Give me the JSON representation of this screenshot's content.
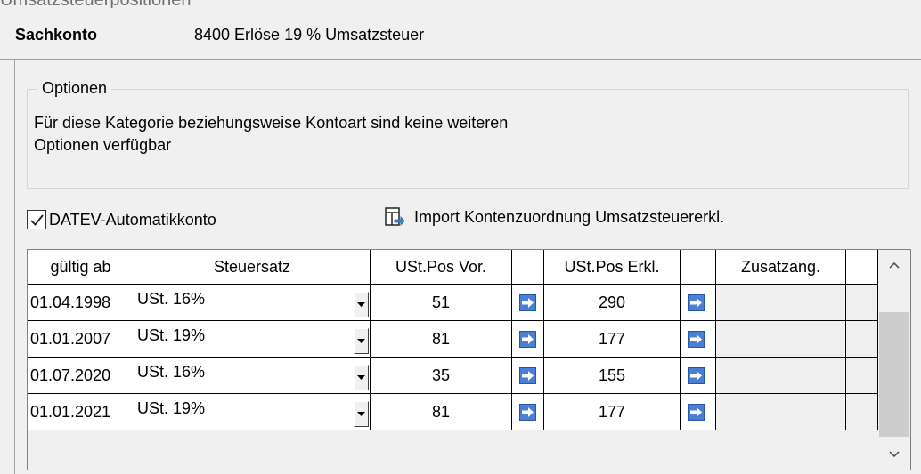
{
  "window_title": "Umsatzsteuerpositionen",
  "header": {
    "label": "Sachkonto",
    "value": "8400 Erlöse 19 % Umsatzsteuer"
  },
  "options": {
    "legend": "Optionen",
    "line1": "Für diese Kategorie beziehungsweise Kontoart sind keine weiteren",
    "line2": "Optionen verfügbar"
  },
  "datev_checkbox": {
    "label": "DATEV-Automatikkonto",
    "checked": true
  },
  "import_button": {
    "label": "Import Kontenzuordnung Umsatzsteuererkl.",
    "icon": "import-icon"
  },
  "grid": {
    "columns": {
      "gueltig_ab": "gültig ab",
      "steuersatz": "Steuersatz",
      "ust_pos_vor": "USt.Pos Vor.",
      "ust_pos_erkl": "USt.Pos Erkl.",
      "zusatzang": "Zusatzang."
    },
    "rows": [
      {
        "gueltig_ab": "01.04.1998",
        "steuersatz": "USt. 16%",
        "ust_pos_vor": "51",
        "ust_pos_erkl": "290"
      },
      {
        "gueltig_ab": "01.01.2007",
        "steuersatz": "USt. 19%",
        "ust_pos_vor": "81",
        "ust_pos_erkl": "177"
      },
      {
        "gueltig_ab": "01.07.2020",
        "steuersatz": "USt. 16%",
        "ust_pos_vor": "35",
        "ust_pos_erkl": "155"
      },
      {
        "gueltig_ab": "01.01.2021",
        "steuersatz": "USt. 19%",
        "ust_pos_vor": "81",
        "ust_pos_erkl": "177"
      }
    ]
  },
  "colors": {
    "accent_button": "#4a7fd4",
    "background": "#f0f0f0",
    "grid_border": "#000000"
  }
}
